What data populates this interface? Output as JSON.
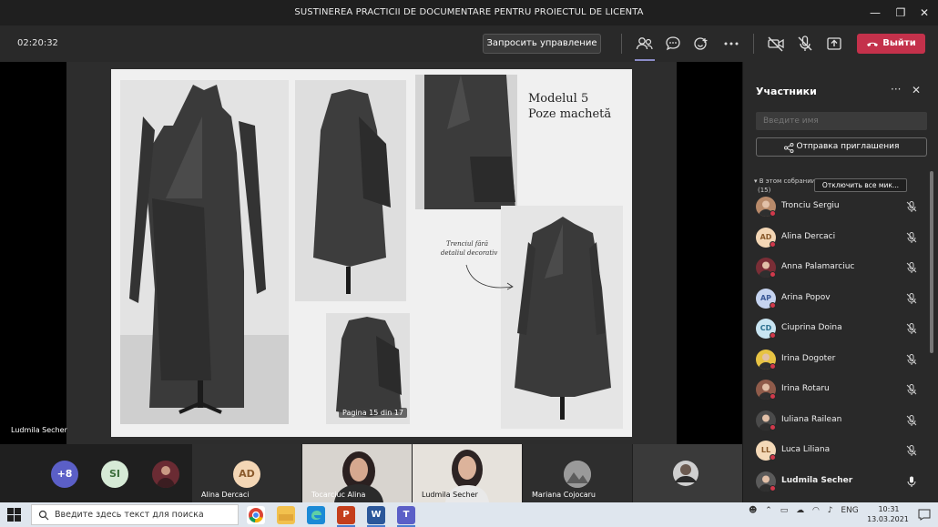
{
  "window": {
    "title": "SUSTINEREA PRACTICII DE DOCUMENTARE PENTRU PROIECTUL DE LICENTA",
    "minimize": "—",
    "maximize": "❐",
    "close": "✕"
  },
  "toolbar": {
    "timer": "02:20:32",
    "request_control_label": "Запросить управление",
    "leave_label": "Выйти",
    "icons": [
      "people-icon",
      "chat-icon",
      "reactions-icon",
      "more-icon",
      "camera-off-icon",
      "mic-off-icon",
      "share-icon",
      "phone-hangup-icon"
    ],
    "accent_color": "#c4314b"
  },
  "stage": {
    "presenter_name": "Ludmila Secher",
    "slide": {
      "title_line1": "Modelul 5",
      "title_line2": "Poze machetă",
      "note_line1": "Trenciul fără",
      "note_line2": "detaliul decorativ",
      "page_indicator": "Pagina 15 din 17"
    }
  },
  "panel": {
    "title": "Участники",
    "more": "···",
    "close": "✕",
    "search_placeholder": "Введите имя",
    "invite_label": "Отправка приглашения",
    "section_label_line1": "В этом собрании",
    "section_label_line2": "(15)",
    "mute_all_label": "Отключить все мик...",
    "participants": [
      {
        "name": "Tronciu Sergiu",
        "initials": "",
        "avatar": "photo",
        "bg": "#b88a6a",
        "mic": "muted"
      },
      {
        "name": "Alina Dercaci",
        "initials": "AD",
        "avatar": "initials",
        "bg": "#f3d6b5",
        "fg": "#8a5a2b",
        "mic": "muted"
      },
      {
        "name": "Anna Palamarciuc",
        "initials": "",
        "avatar": "photo",
        "bg": "#7a2e36",
        "mic": "muted"
      },
      {
        "name": "Arina Popov",
        "initials": "AP",
        "avatar": "initials",
        "bg": "#c6d4f0",
        "fg": "#3b5998",
        "mic": "muted"
      },
      {
        "name": "Ciuprina Doina",
        "initials": "CD",
        "avatar": "initials",
        "bg": "#c9e5f2",
        "fg": "#2a6f8e",
        "mic": "muted"
      },
      {
        "name": "Irina Dogoter",
        "initials": "",
        "avatar": "photo",
        "bg": "#e7c343",
        "mic": "muted"
      },
      {
        "name": "Irina Rotaru",
        "initials": "",
        "avatar": "photo",
        "bg": "#8f5b4a",
        "mic": "muted"
      },
      {
        "name": "Iuliana Railean",
        "initials": "",
        "avatar": "photo",
        "bg": "#4a4a4a",
        "mic": "muted"
      },
      {
        "name": "Luca Liliana",
        "initials": "LL",
        "avatar": "initials",
        "bg": "#f4d9b8",
        "fg": "#8a5a2b",
        "mic": "muted"
      },
      {
        "name": "Ludmila Secher",
        "initials": "",
        "avatar": "photo",
        "bg": "#5a5a5a",
        "mic": "on",
        "bold": true
      }
    ]
  },
  "strip": {
    "overflow_count": "+8",
    "si_initials": "SI",
    "tiles": [
      {
        "label": "Alina Dercaci",
        "initials": "AD"
      },
      {
        "label": "Tocarciuc Alina"
      },
      {
        "label": "Ludmila Secher"
      },
      {
        "label": "Mariana Cojocaru"
      }
    ]
  },
  "taskbar": {
    "search_placeholder": "Введите здесь текст для поиска",
    "apps": [
      "chrome-icon",
      "file-explorer-icon",
      "edge-icon",
      "powerpoint-icon",
      "word-icon",
      "teams-icon"
    ],
    "tray_lang": "ENG",
    "time": "10:31",
    "date": "13.03.2021"
  }
}
